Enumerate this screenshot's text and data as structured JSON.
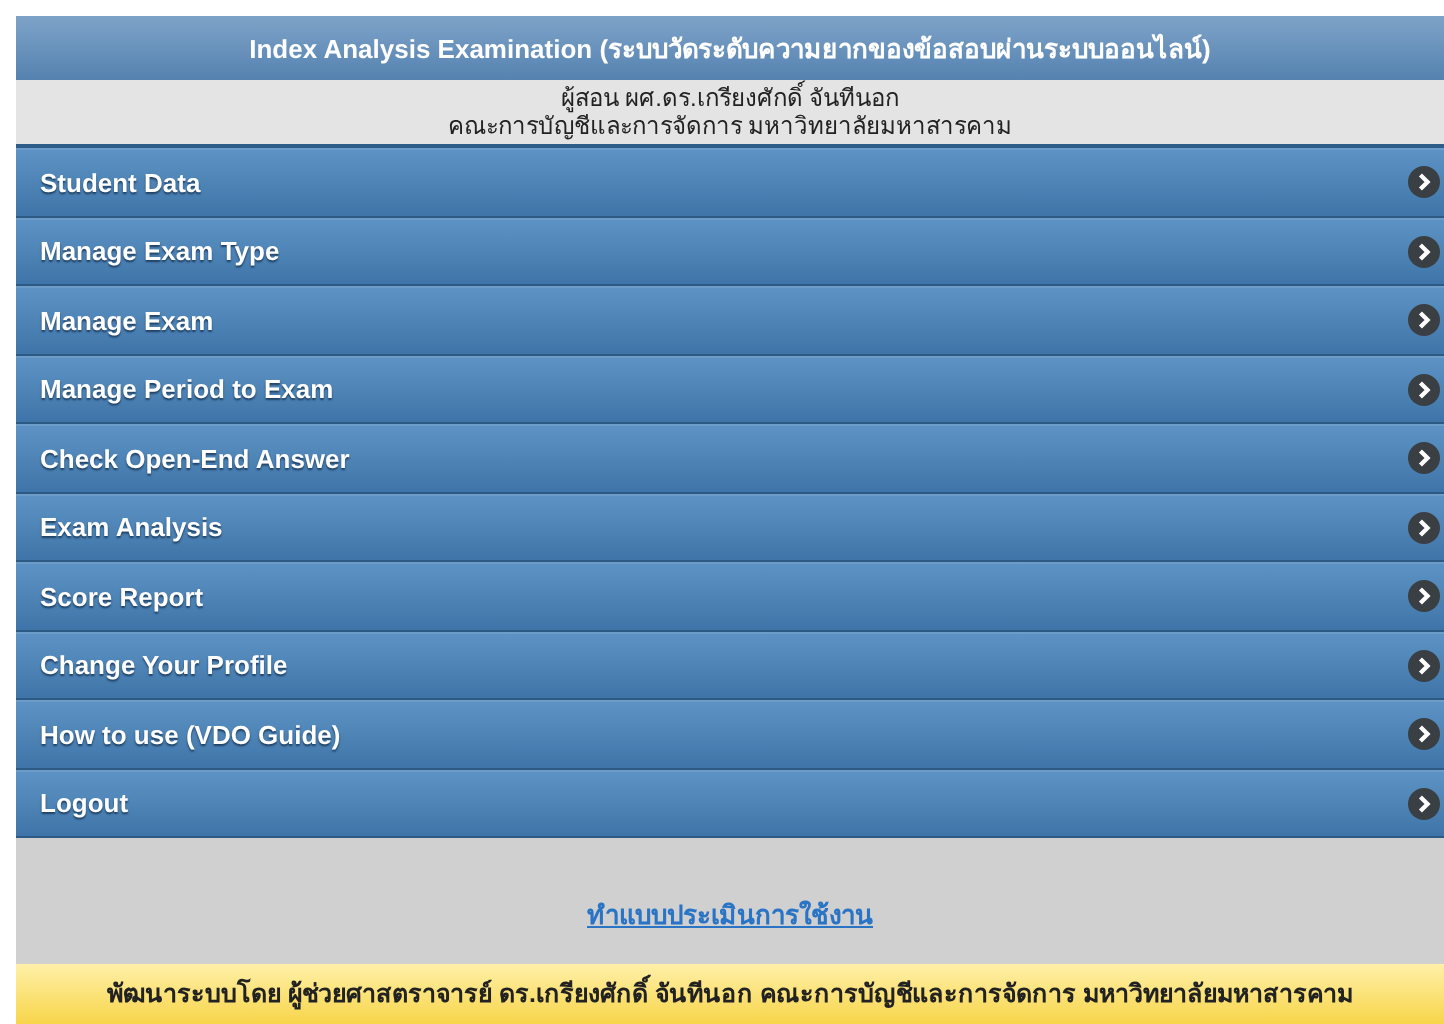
{
  "header": {
    "title": "Index Analysis Examination (ระบบวัดระดับความยากของข้อสอบผ่านระบบออนไลน์)",
    "instructor": "ผู้สอน ผศ.ดร.เกรียงศักดิ์ จันทีนอก",
    "faculty": "คณะการบัญชีและการจัดการ มหาวิทยาลัยมหาสารคาม"
  },
  "menu": [
    {
      "label": "Student Data"
    },
    {
      "label": "Manage Exam Type"
    },
    {
      "label": "Manage Exam"
    },
    {
      "label": "Manage Period to Exam"
    },
    {
      "label": "Check Open-End Answer"
    },
    {
      "label": "Exam Analysis"
    },
    {
      "label": "Score Report"
    },
    {
      "label": "Change Your Profile"
    },
    {
      "label": "How to use (VDO Guide)"
    },
    {
      "label": "Logout"
    }
  ],
  "survey_link": "ทำแบบประเมินการใช้งาน",
  "footer": "พัฒนาระบบโดย ผู้ช่วยศาสตราจารย์ ดร.เกรียงศักดิ์ จันทีนอก คณะการบัญชีและการจัดการ มหาวิทยาลัยมหาสารคาม"
}
